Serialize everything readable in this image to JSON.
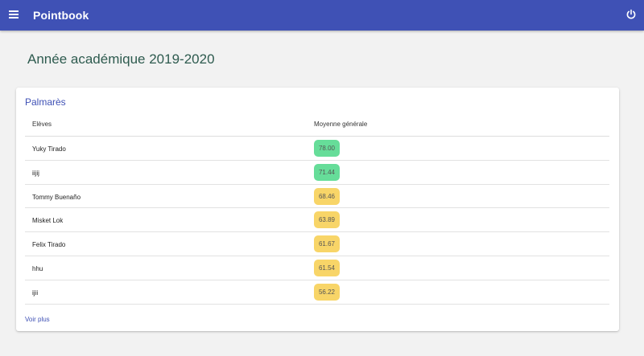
{
  "app": {
    "title": "Pointbook",
    "menu_icon": "menu-icon",
    "power_icon": "power-icon",
    "primary_color": "#3f51b5"
  },
  "page": {
    "title": "Année académique 2019-2020"
  },
  "palmares": {
    "title": "Palmarès",
    "columns": [
      "Elèves",
      "Moyenne générale"
    ],
    "rows": [
      {
        "name": "Yuky Tirado",
        "average": "78.00",
        "status": "green"
      },
      {
        "name": "iijij",
        "average": "71.44",
        "status": "green"
      },
      {
        "name": "Tommy Buenaño",
        "average": "68.46",
        "status": "yellow"
      },
      {
        "name": "Misket Lok",
        "average": "63.89",
        "status": "yellow"
      },
      {
        "name": "Felix Tirado",
        "average": "61.67",
        "status": "yellow"
      },
      {
        "name": "hhu",
        "average": "61.54",
        "status": "yellow"
      },
      {
        "name": "ijii",
        "average": "56.22",
        "status": "yellow"
      }
    ],
    "more_link": "Voir plus",
    "badge_colors": {
      "green": "#66dd99",
      "yellow": "#f8d568"
    }
  }
}
